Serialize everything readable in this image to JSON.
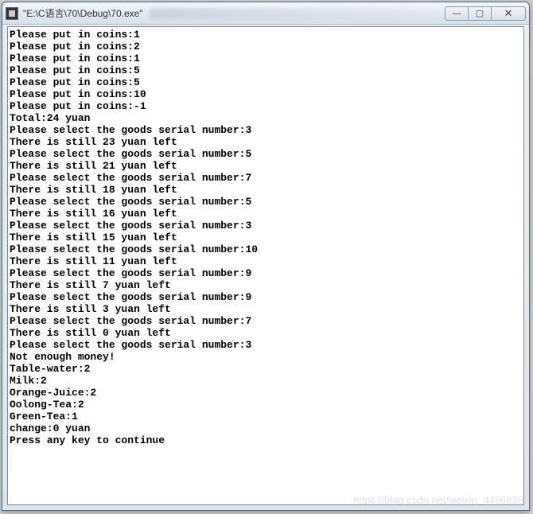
{
  "window": {
    "title": "\"E:\\C语言\\70\\Debug\\70.exe\""
  },
  "controls": {
    "minimize": "—",
    "maximize": "▢",
    "close": "✕"
  },
  "console_lines": [
    "Please put in coins:1",
    "Please put in coins:2",
    "Please put in coins:1",
    "Please put in coins:5",
    "Please put in coins:5",
    "Please put in coins:10",
    "Please put in coins:-1",
    "Total:24 yuan",
    "Please select the goods serial number:3",
    "There is still 23 yuan left",
    "Please select the goods serial number:5",
    "There is still 21 yuan left",
    "Please select the goods serial number:7",
    "There is still 18 yuan left",
    "Please select the goods serial number:5",
    "There is still 16 yuan left",
    "Please select the goods serial number:3",
    "There is still 15 yuan left",
    "Please select the goods serial number:10",
    "There is still 11 yuan left",
    "Please select the goods serial number:9",
    "There is still 7 yuan left",
    "Please select the goods serial number:9",
    "There is still 3 yuan left",
    "Please select the goods serial number:7",
    "There is still 0 yuan left",
    "Please select the goods serial number:3",
    "Not enough money!",
    "Table-water:2",
    "Milk:2",
    "Orange-Juice:2",
    "Oolong-Tea:2",
    "Green-Tea:1",
    "change:0 yuan",
    "Press any key to continue"
  ],
  "watermark": "https://blog.csdn.net/weixin_4486838"
}
